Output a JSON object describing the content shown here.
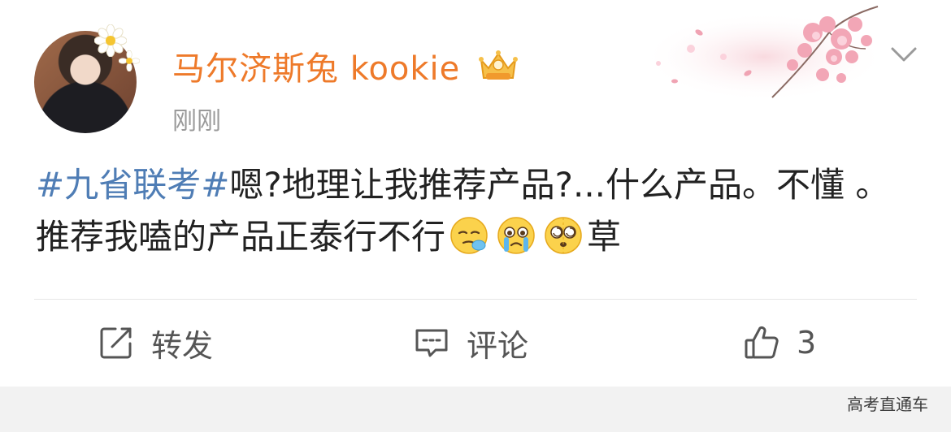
{
  "post": {
    "author": {
      "name": "马尔济斯兔 kookie",
      "badge_icon": "vip-crown-icon"
    },
    "timestamp": "刚刚",
    "text": {
      "hashtag": "#九省联考#",
      "body_1": "嗯?地理让我推荐产品?...什么产品。不懂 。推荐我嗑的产品正泰行不行",
      "emojis": [
        "sleepy-emoji",
        "crying-emoji",
        "dizzy-emoji"
      ],
      "body_2": "草"
    }
  },
  "actions": {
    "repost_label": "转发",
    "comment_label": "评论",
    "like_count": "3"
  },
  "watermark": "高考直通车",
  "colors": {
    "username": "#ee7a2a",
    "hashtag": "#4f7db5",
    "timestamp": "#9a9a9a",
    "action_text": "#555555"
  }
}
